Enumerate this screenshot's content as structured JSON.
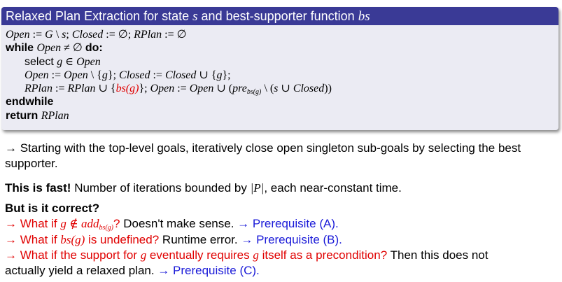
{
  "block": {
    "title_text": "Relaxed Plan Extraction for state ",
    "title_s": "s",
    "title_mid": " and best-supporter function ",
    "title_bs": "bs"
  },
  "algorithm": {
    "line1": [
      "Open",
      " := ",
      "G",
      " \\ ",
      "s",
      "; ",
      "Closed",
      " := ∅; ",
      "RPlan",
      " := ∅"
    ],
    "while_kw": "while",
    "while_cond": [
      "Open",
      " ≠ ∅ "
    ],
    "do_kw": "do:",
    "select_kw": "select",
    "select_expr": [
      "g",
      " ∈ ",
      "Open"
    ],
    "line4": [
      "Open",
      " := ",
      "Open",
      " \\ {",
      "g",
      "}; ",
      "Closed",
      " := ",
      "Closed",
      " ∪ {",
      "g",
      "};"
    ],
    "line5": {
      "a": [
        "RPlan",
        " := ",
        "RPlan",
        " ∪ {"
      ],
      "red": "bs(g)",
      "b": "}; ",
      "c": [
        "Open",
        " := ",
        "Open",
        " ∪ ("
      ],
      "pre": "pre",
      "pre_sub": "bs(g)",
      "d": " \\ (",
      "e": "s",
      "f": " ∪ ",
      "g": "Closed",
      "h": "))"
    },
    "endwhile_kw": "endwhile",
    "return_kw": "return",
    "return_val": "RPlan"
  },
  "content": {
    "p1": "→ Starting with the top-level goals, iteratively close open singleton sub-goals by selecting the best supporter.",
    "p2_bold": "This is fast!",
    "p2_a": " Number of iterations bounded by ",
    "p2_math": "|P|",
    "p2_b": ", each near-constant time.",
    "q_heading": "But is it correct?",
    "q1_red_a": "→ What if ",
    "q1_m1": "g",
    "q1_m2": " ∉ ",
    "q1_m3": "add",
    "q1_sub": "bs(g)",
    "q1_red_b": "?",
    "q1_black": " Doesn't make sense. ",
    "q1_blue": "→ Prerequisite (A).",
    "q2_red_a": "→ What if ",
    "q2_math": "bs(g)",
    "q2_red_b": " is undefined?",
    "q2_black": " Runtime error. ",
    "q2_blue": "→ Prerequisite (B).",
    "q3_red_a": "→ What if the support for ",
    "q3_m1": "g",
    "q3_red_b": " eventually requires ",
    "q3_m2": "g",
    "q3_red_c": " itself as a precondition?",
    "q3_black_a": " Then this does not",
    "q3_black_b": "actually yield a relaxed plan. ",
    "q3_blue": "→ Prerequisite (C)."
  },
  "colors": {
    "title_bar": "#3a3a96",
    "block_bg": "#ebebf3",
    "red": "#e00000",
    "blue": "#1a1ad8"
  }
}
